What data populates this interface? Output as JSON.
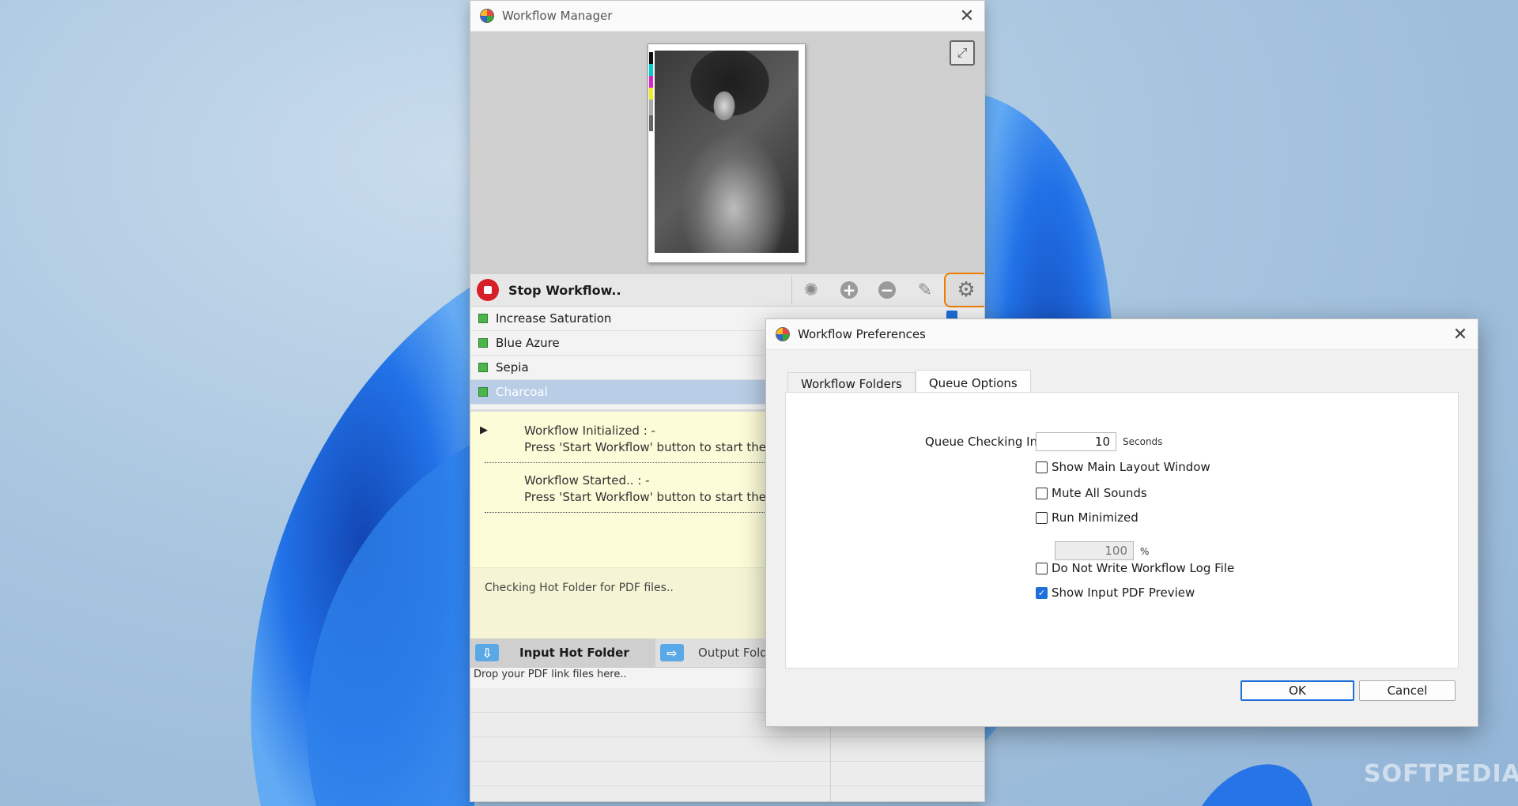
{
  "watermark": "SOFTPEDIA",
  "manager": {
    "title": "Workflow Manager",
    "stop_label": "Stop Workflow..",
    "flows": [
      {
        "label": "Increase Saturation"
      },
      {
        "label": "Blue Azure"
      },
      {
        "label": "Sepia"
      },
      {
        "label": "Charcoal"
      }
    ],
    "log": [
      {
        "heading": "Workflow Initialized  :   -",
        "message": "Press 'Start Workflow' button to start the wo"
      },
      {
        "heading": "Workflow Started..   :   -",
        "message": "Press 'Start Workflow' button to start the wo"
      }
    ],
    "status": "Checking Hot Folder for PDF files..",
    "folder_tabs": {
      "input": "Input Hot Folder",
      "output": "Output Folder"
    },
    "drop_hint": "Drop your PDF link files here.."
  },
  "prefs": {
    "title": "Workflow Preferences",
    "tabs": [
      "Workflow Folders",
      "Queue Options"
    ],
    "active_tab": "Queue Options",
    "interval_label": "Queue Checking Interval:",
    "interval_value": "10",
    "interval_unit": "Seconds",
    "options": [
      {
        "label": "Show Main Layout Window",
        "checked": false
      },
      {
        "label": "Mute All Sounds",
        "checked": false
      },
      {
        "label": "Run Minimized",
        "checked": false
      },
      {
        "label": "Do Not Write Workflow Log File",
        "checked": false
      },
      {
        "label": "Show Input PDF Preview",
        "checked": true
      }
    ],
    "minimized_value": "100",
    "minimized_unit": "%",
    "ok_label": "OK",
    "cancel_label": "Cancel"
  }
}
